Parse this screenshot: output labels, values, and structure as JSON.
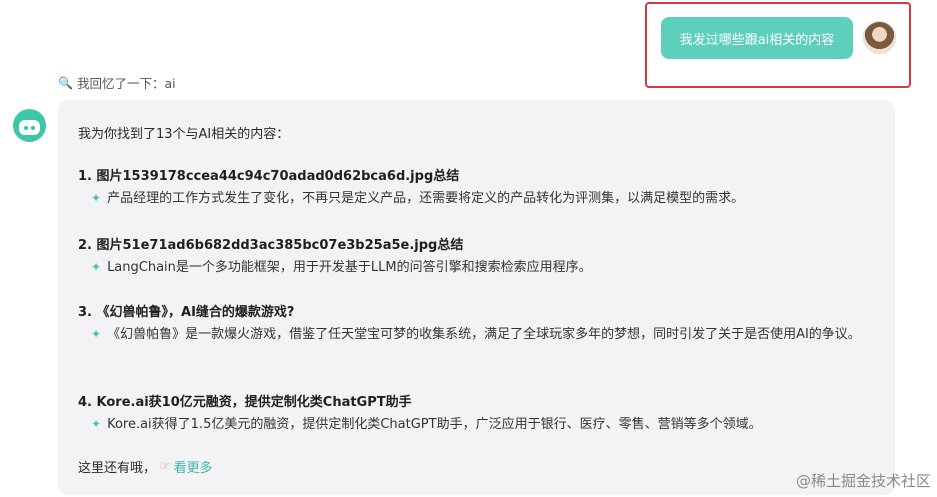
{
  "user_message": "我发过哪些跟ai相关的内容",
  "recall": {
    "icon": "magnifier",
    "text": "我回忆了一下：ai"
  },
  "answer": {
    "intro": "我为你找到了13个与AI相关的内容：",
    "items": [
      {
        "title": "1. 图片1539178ccea44c94c70adad0d62bca6d.jpg总结",
        "desc": "产品经理的工作方式发生了变化，不再只是定义产品，还需要将定义的产品转化为评测集，以满足模型的需求。"
      },
      {
        "title": "2. 图片51e71ad6b682dd3ac385bc07e3b25a5e.jpg总结",
        "desc": "LangChain是一个多功能框架，用于开发基于LLM的问答引擎和搜索检索应用程序。"
      },
      {
        "title": "3. 《幻兽帕鲁》，AI缝合的爆款游戏?",
        "desc": "《幻兽帕鲁》是一款爆火游戏，借鉴了任天堂宝可梦的收集系统，满足了全球玩家多年的梦想，同时引发了关于是否使用AI的争议。"
      },
      {
        "title": "4. Kore.ai获10亿元融资，提供定制化类ChatGPT助手",
        "desc": "Kore.ai获得了1.5亿美元的融资，提供定制化类ChatGPT助手，广泛应用于银行、医疗、零售、营销等多个领域。"
      }
    ],
    "footer_text": "这里还有哦，",
    "more_label": "看更多"
  },
  "watermark": "@稀土掘金技术社区",
  "colors": {
    "bubble": "#5fcfbd",
    "highlight_frame": "#d63a3a",
    "link": "#3ab8a6",
    "card": "#f3f3f5"
  }
}
